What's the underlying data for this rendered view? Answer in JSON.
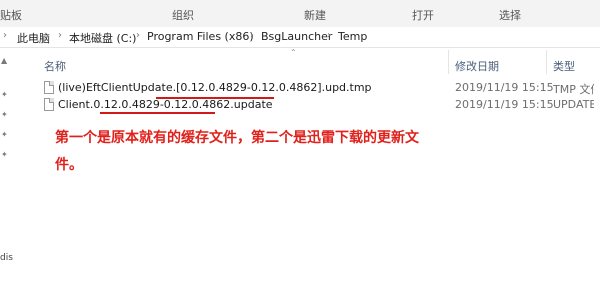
{
  "ribbon": {
    "items": [
      "贴板",
      "组织",
      "新建",
      "打开",
      "选择"
    ]
  },
  "address": {
    "segments": [
      "此电脑",
      "本地磁盘 (C:)",
      "Program Files (x86)",
      "BsgLauncher",
      "Temp"
    ]
  },
  "nav": {
    "partial_label": "dis"
  },
  "columns": {
    "name": "名称",
    "modified": "修改日期",
    "type": "类型"
  },
  "files": [
    {
      "name": "(live)EftClientUpdate.[0.12.0.4829-0.12.0.4862].upd.tmp",
      "modified": "2019/11/19 15:15",
      "type": "TMP 文件"
    },
    {
      "name": "Client.0.12.0.4829-0.12.0.4862.update",
      "modified": "2019/11/19 15:15",
      "type": "UPDATE"
    }
  ],
  "annotation": {
    "text": "第一个是原本就有的缓存文件，第二个是迅雷下载的更新文件。",
    "color": "#e0211b"
  }
}
